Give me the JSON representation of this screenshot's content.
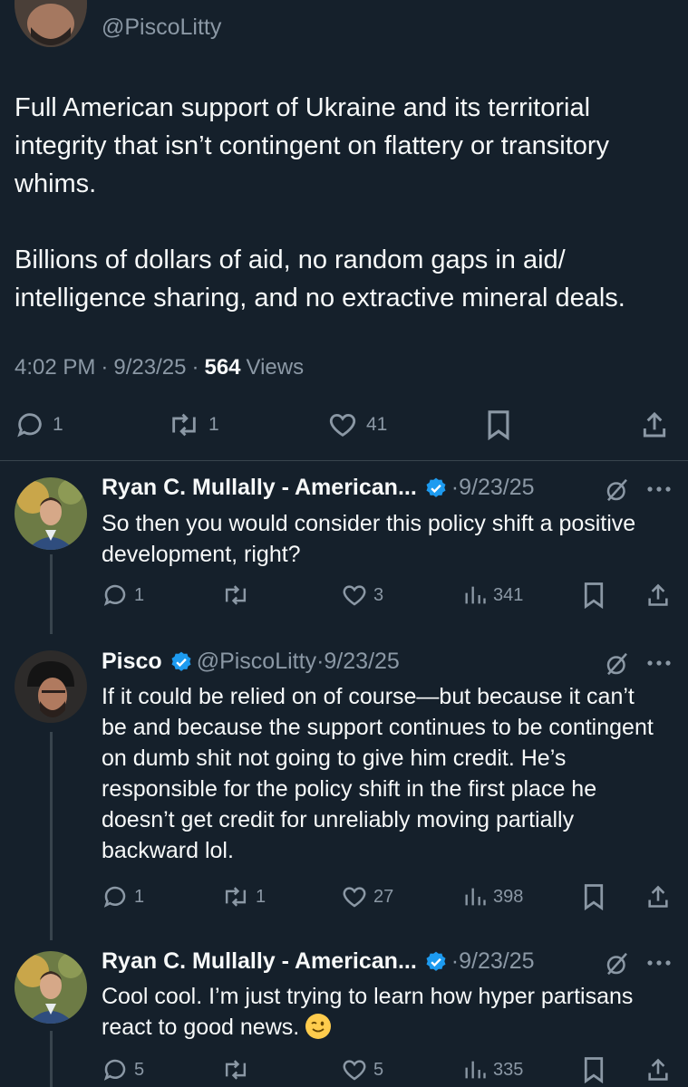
{
  "top": {
    "handle": "@PiscoLitty"
  },
  "main": {
    "text": "Full American support of Ukraine and its territorial integrity that isn’t contingent on flattery or transitory whims.\n\nBillions of dollars of aid, no random gaps in aid/ intelligence sharing, and no extractive mineral deals.",
    "time": "4:02 PM",
    "date": "9/23/25",
    "views_count": "564",
    "views_label": "Views",
    "replies": "1",
    "reposts": "1",
    "likes": "41"
  },
  "replies": [
    {
      "name": "Ryan C. Mullally - American...",
      "handle": "",
      "date": "9/23/25",
      "text": "So then you would consider this policy shift a positive development, right?",
      "replies": "1",
      "reposts": "",
      "likes": "3",
      "views": "341"
    },
    {
      "name": "Pisco",
      "handle": "@PiscoLitty",
      "date": "9/23/25",
      "text": "If it could be relied on of course—but because it can’t be and because the support continues to be contingent on dumb shit not going to give him credit. He’s responsible for the policy shift in the first place he doesn’t get credit for unreliably moving partially backward lol.",
      "replies": "1",
      "reposts": "1",
      "likes": "27",
      "views": "398"
    },
    {
      "name": "Ryan C. Mullally - American...",
      "handle": "",
      "date": "9/23/25",
      "text": "Cool cool.  I’m just trying to learn how hyper partisans react to good news.",
      "replies": "5",
      "reposts": "",
      "likes": "5",
      "views": "335"
    }
  ],
  "icons": {
    "reply": "reply-icon",
    "repost": "repost-icon",
    "like": "heart-icon",
    "views": "views-icon",
    "bookmark": "bookmark-icon",
    "share": "share-icon",
    "verified": "verified-badge-icon",
    "grok": "grok-icon",
    "more": "more-icon",
    "emoji": "winking-face-emoji"
  },
  "colors": {
    "background": "#15202b",
    "text": "#f7f9f9",
    "muted": "#8b98a5",
    "verified": "#1d9bf0"
  }
}
